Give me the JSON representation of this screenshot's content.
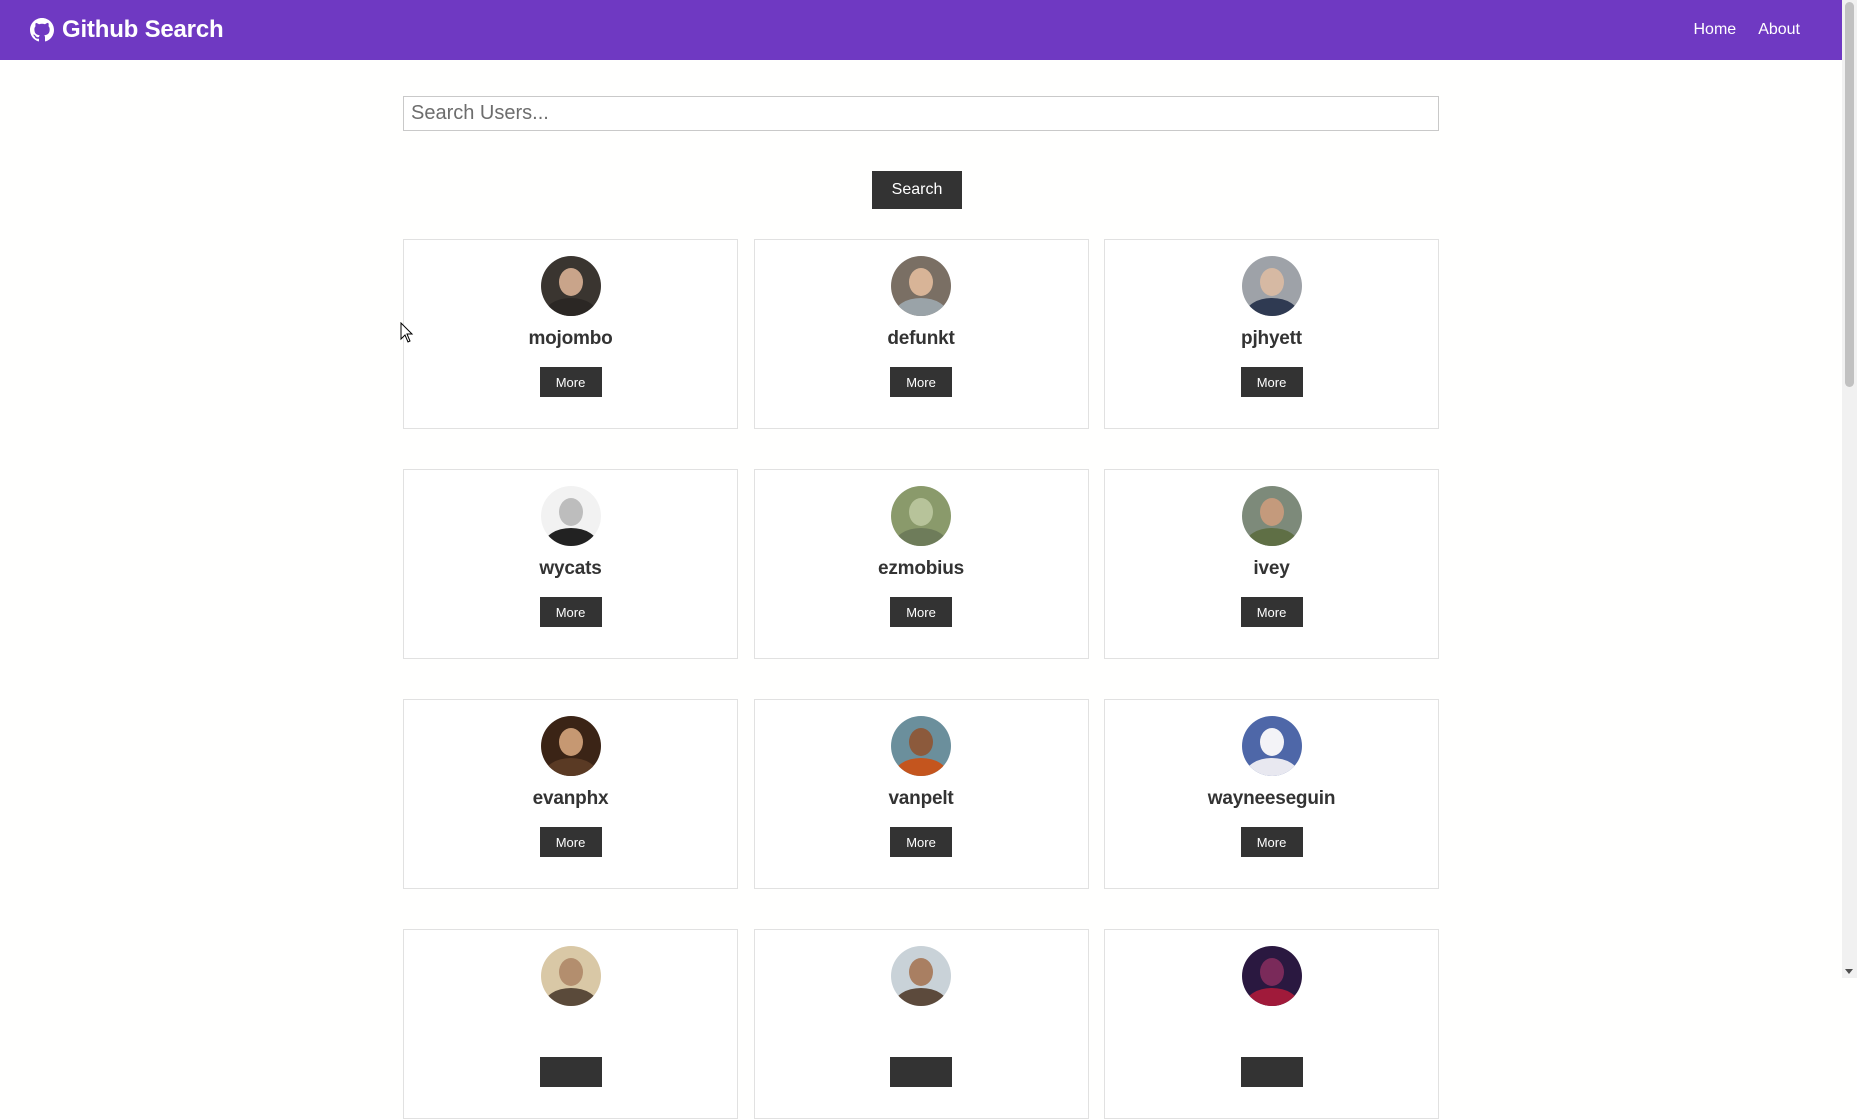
{
  "navbar": {
    "brand": "Github Search",
    "links": [
      "Home",
      "About"
    ]
  },
  "search": {
    "placeholder": "Search Users...",
    "value": "",
    "button_label": "Search"
  },
  "users": [
    {
      "login": "mojombo",
      "more_label": "More",
      "avatar_colors": [
        "#3a3530",
        "#2b2724",
        "#c9a48a"
      ]
    },
    {
      "login": "defunkt",
      "more_label": "More",
      "avatar_colors": [
        "#7a6f64",
        "#9aa3a8",
        "#d8b497"
      ]
    },
    {
      "login": "pjhyett",
      "more_label": "More",
      "avatar_colors": [
        "#9ea2a8",
        "#2f3a52",
        "#d6b9a3"
      ]
    },
    {
      "login": "wycats",
      "more_label": "More",
      "avatar_colors": [
        "#f2f2f2",
        "#222222",
        "#bdbdbd"
      ]
    },
    {
      "login": "ezmobius",
      "more_label": "More",
      "avatar_colors": [
        "#8a9a6b",
        "#6e7c5a",
        "#b7c39a"
      ]
    },
    {
      "login": "ivey",
      "more_label": "More",
      "avatar_colors": [
        "#7d8a7a",
        "#5f6f45",
        "#c49a7c"
      ]
    },
    {
      "login": "evanphx",
      "more_label": "More",
      "avatar_colors": [
        "#3b2416",
        "#5a3a24",
        "#c69872"
      ]
    },
    {
      "login": "vanpelt",
      "more_label": "More",
      "avatar_colors": [
        "#6b8f9c",
        "#c4551e",
        "#8c5a3c"
      ]
    },
    {
      "login": "wayneeseguin",
      "more_label": "More",
      "avatar_colors": [
        "#4e67a8",
        "#e8e8f0",
        "#f3f3f7"
      ]
    },
    {
      "login": "",
      "more_label": "",
      "avatar_colors": [
        "#d9c8a6",
        "#5a4a3a",
        "#b38e6e"
      ]
    },
    {
      "login": "",
      "more_label": "",
      "avatar_colors": [
        "#c9d2d8",
        "#5c4a3c",
        "#a97f62"
      ]
    },
    {
      "login": "",
      "more_label": "",
      "avatar_colors": [
        "#2a1840",
        "#a01a3a",
        "#7a2a5a"
      ]
    }
  ]
}
